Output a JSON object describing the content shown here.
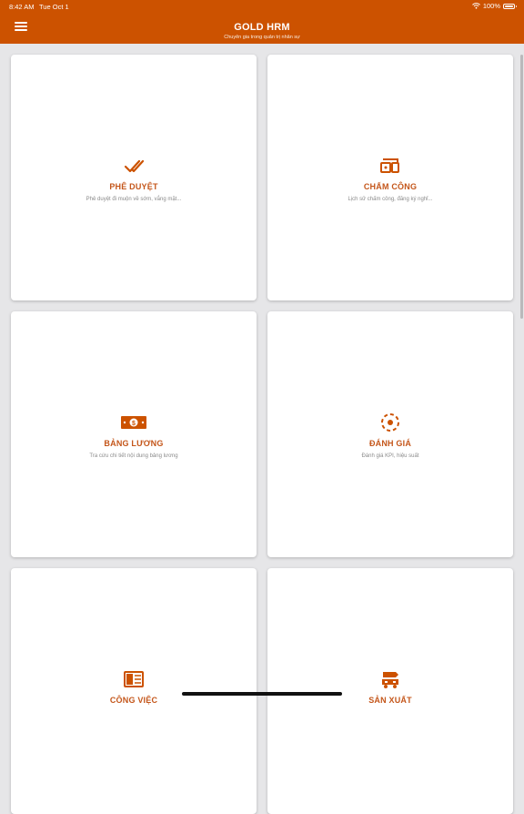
{
  "status_bar": {
    "time": "8:42 AM",
    "date": "Tue Oct 1",
    "battery": "100%"
  },
  "header": {
    "title": "GOLD HRM",
    "subtitle": "Chuyên gia trong quản trị nhân sự"
  },
  "accent_color": "#cc5200",
  "cards": [
    {
      "label": "PHÊ DUYỆT",
      "desc": "Phê duyệt đi muộn về sớm, vắng mặt...",
      "icon": "double-check-icon"
    },
    {
      "label": "CHẤM CÔNG",
      "desc": "Lịch sử chấm công, đăng ký nghỉ...",
      "icon": "devices-icon"
    },
    {
      "label": "BẢNG LƯƠNG",
      "desc": "Tra cứu chi tiết nội dung bảng lương",
      "icon": "money-icon"
    },
    {
      "label": "ĐÁNH GIÁ",
      "desc": "Đánh giá KPI, hiệu suất",
      "icon": "target-icon"
    },
    {
      "label": "CÔNG VIỆC",
      "desc": "",
      "icon": "task-icon"
    },
    {
      "label": "SẢN XUẤT",
      "desc": "",
      "icon": "production-icon"
    }
  ]
}
